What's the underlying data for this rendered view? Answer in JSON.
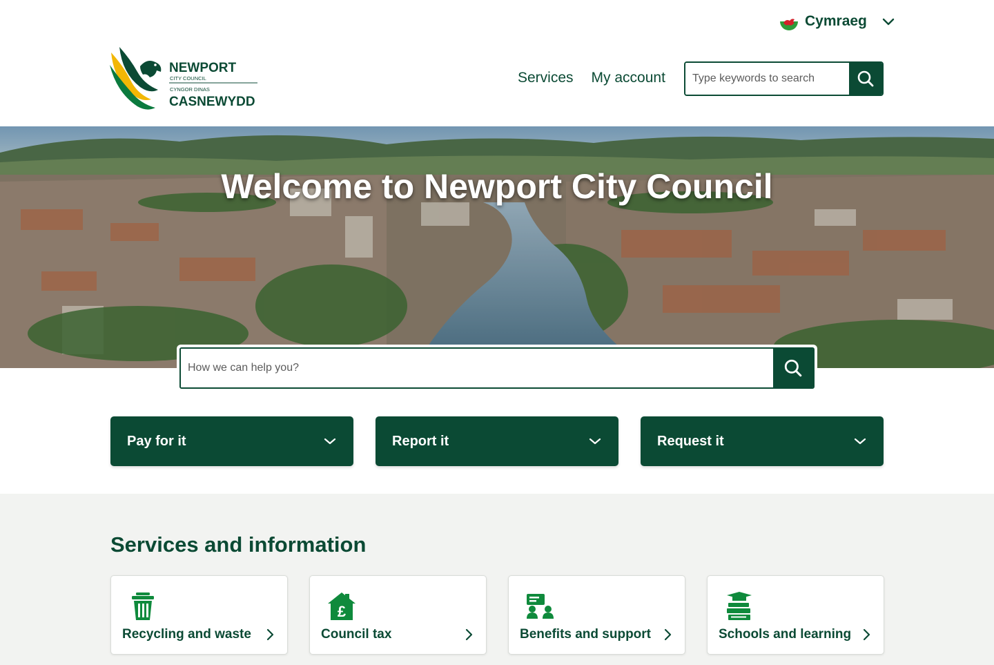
{
  "language": {
    "label": "Cymraeg",
    "flag_icon": "welsh-flag-icon"
  },
  "logo": {
    "line1": "NEWPORT",
    "line2": "CITY COUNCIL",
    "line3": "CYNGOR DINAS",
    "line4": "CASNEWYDD"
  },
  "nav": {
    "items": [
      {
        "label": "Services"
      },
      {
        "label": "My account"
      }
    ]
  },
  "header_search": {
    "placeholder": "Type keywords to search",
    "icon": "search-icon"
  },
  "hero": {
    "title": "Welcome to Newport City Council",
    "search_placeholder": "How we can help you?",
    "image": "aerial view of Newport city and River Usk"
  },
  "quick_actions": [
    {
      "label": "Pay for it",
      "icon": "chevron-down-icon"
    },
    {
      "label": "Report it",
      "icon": "chevron-down-icon"
    },
    {
      "label": "Request it",
      "icon": "chevron-down-icon"
    }
  ],
  "services": {
    "title": "Services and information",
    "cards": [
      {
        "label": "Recycling and waste",
        "icon": "trash-bin-icon"
      },
      {
        "label": "Council tax",
        "icon": "house-pound-icon"
      },
      {
        "label": "Benefits and support",
        "icon": "people-support-icon"
      },
      {
        "label": "Schools and learning",
        "icon": "books-graduation-icon"
      }
    ]
  },
  "colors": {
    "brand_green": "#0b4a34",
    "accent_yellow": "#f2b705",
    "section_bg": "#f2f3f1"
  }
}
